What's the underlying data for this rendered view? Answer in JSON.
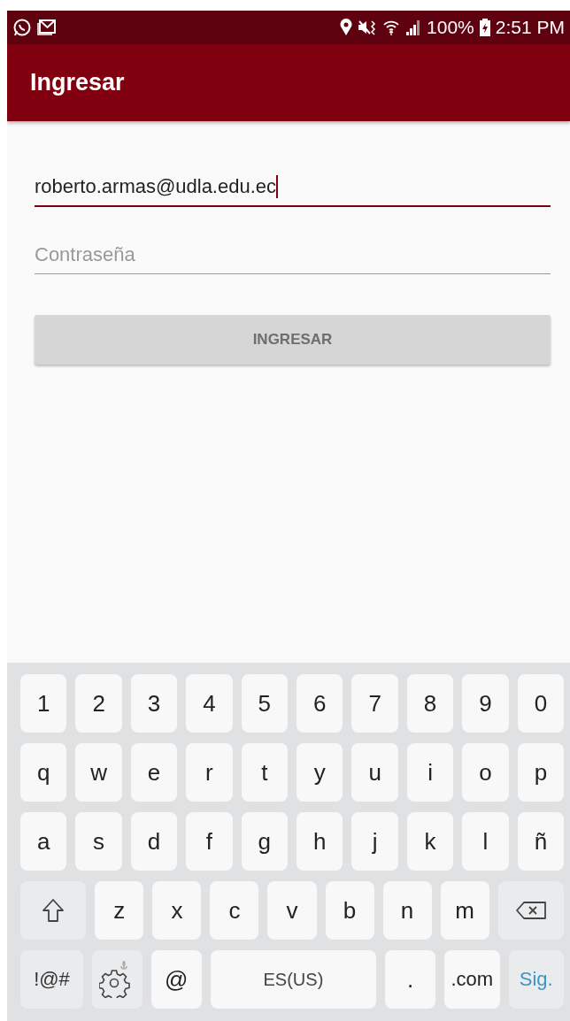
{
  "status_bar": {
    "battery": "100%",
    "time": "2:51 PM"
  },
  "app_bar": {
    "title": "Ingresar"
  },
  "form": {
    "fields": [
      {
        "value": "roberto.armas@udla.edu.ec",
        "focused": true
      },
      {
        "placeholder": "Contraseña",
        "focused": false
      }
    ],
    "button": {
      "label": "INGRESAR",
      "disabled": true
    }
  },
  "keyboard": {
    "key_rows": [
      {
        "keys": [
          {
            "kind": "char",
            "label": "1"
          },
          {
            "kind": "char",
            "label": "2"
          },
          {
            "kind": "char",
            "label": "3"
          },
          {
            "kind": "char",
            "label": "4"
          },
          {
            "kind": "char",
            "label": "5"
          },
          {
            "kind": "char",
            "label": "6"
          },
          {
            "kind": "char",
            "label": "7"
          },
          {
            "kind": "char",
            "label": "8"
          },
          {
            "kind": "char",
            "label": "9"
          },
          {
            "kind": "char",
            "label": "0"
          }
        ]
      },
      {
        "keys": [
          {
            "kind": "char",
            "label": "q"
          },
          {
            "kind": "char",
            "label": "w"
          },
          {
            "kind": "char",
            "label": "e"
          },
          {
            "kind": "char",
            "label": "r"
          },
          {
            "kind": "char",
            "label": "t"
          },
          {
            "kind": "char",
            "label": "y"
          },
          {
            "kind": "char",
            "label": "u"
          },
          {
            "kind": "char",
            "label": "i"
          },
          {
            "kind": "char",
            "label": "o"
          },
          {
            "kind": "char",
            "label": "p"
          }
        ]
      },
      {
        "keys": [
          {
            "kind": "char",
            "label": "a"
          },
          {
            "kind": "char",
            "label": "s"
          },
          {
            "kind": "char",
            "label": "d"
          },
          {
            "kind": "char",
            "label": "f"
          },
          {
            "kind": "char",
            "label": "g"
          },
          {
            "kind": "char",
            "label": "h"
          },
          {
            "kind": "char",
            "label": "j"
          },
          {
            "kind": "char",
            "label": "k"
          },
          {
            "kind": "char",
            "label": "l"
          },
          {
            "kind": "char",
            "label": "ñ"
          }
        ]
      },
      {
        "keys": [
          {
            "kind": "shift"
          },
          {
            "kind": "char",
            "label": "z"
          },
          {
            "kind": "char",
            "label": "x"
          },
          {
            "kind": "char",
            "label": "c"
          },
          {
            "kind": "char",
            "label": "v"
          },
          {
            "kind": "char",
            "label": "b"
          },
          {
            "kind": "char",
            "label": "n"
          },
          {
            "kind": "char",
            "label": "m"
          },
          {
            "kind": "backspace"
          }
        ]
      },
      {
        "keys": [
          {
            "kind": "symbols",
            "label": "!@#"
          },
          {
            "kind": "settings"
          },
          {
            "kind": "char",
            "label": "@"
          },
          {
            "kind": "space",
            "label": "ES(US)"
          },
          {
            "kind": "char",
            "label": "."
          },
          {
            "kind": "char",
            "label": ".com"
          },
          {
            "kind": "action",
            "label": "Sig."
          }
        ]
      }
    ]
  }
}
